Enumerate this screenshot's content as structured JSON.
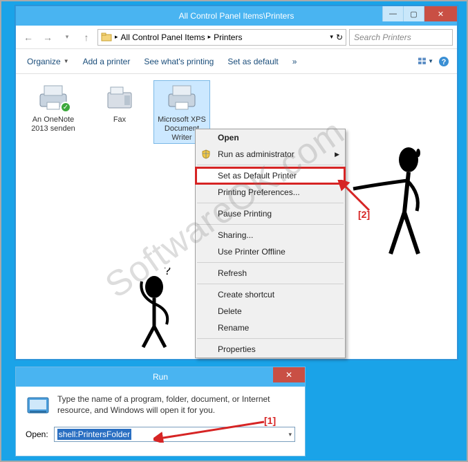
{
  "explorer": {
    "title": "All Control Panel Items\\Printers",
    "nav_back": "←",
    "nav_fwd": "→",
    "nav_up": "↑",
    "breadcrumb": {
      "part1": "All Control Panel Items",
      "part2": "Printers"
    },
    "refresh": "↻",
    "search_placeholder": "Search Printers",
    "toolbar": {
      "organize": "Organize",
      "add": "Add a printer",
      "see": "See what's printing",
      "setdefault": "Set as default",
      "overflow": "»"
    },
    "printers": [
      {
        "label": "An OneNote 2013 senden",
        "default": true
      },
      {
        "label": "Fax",
        "default": false
      },
      {
        "label": "Microsoft XPS Document Writer",
        "default": false
      }
    ]
  },
  "context_menu": {
    "open": "Open",
    "runas": "Run as administrator",
    "setdefault": "Set as Default Printer",
    "prefs": "Printing Preferences...",
    "pause": "Pause Printing",
    "sharing": "Sharing...",
    "offline": "Use Printer Offline",
    "refresh": "Refresh",
    "shortcut": "Create shortcut",
    "delete": "Delete",
    "rename": "Rename",
    "properties": "Properties"
  },
  "run": {
    "title": "Run",
    "desc": "Type the name of a program, folder, document, or Internet resource, and Windows will open it for you.",
    "open_label": "Open:",
    "command": "shell:PrintersFolder"
  },
  "annotations": {
    "a1": "[1]",
    "a2": "[2]"
  },
  "watermark": "SoftwareOK.com"
}
